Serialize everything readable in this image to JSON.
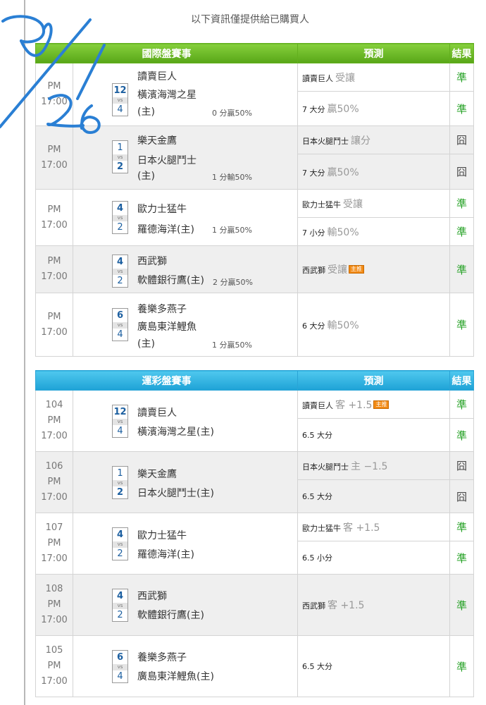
{
  "notice": "以下資訊僅提供給已購買人",
  "intl": {
    "header": {
      "match": "國際盤賽事",
      "pred": "預測",
      "result": "結果"
    },
    "games": [
      {
        "ampm": "PM",
        "time": "17:00",
        "s1": "12",
        "vs": "vs",
        "s2": "4",
        "team1": "讀賣巨人",
        "team2": "橫濱海灣之星",
        "home": "(主)",
        "handicap": "0 分贏50%",
        "pred1_team": "讀賣巨人",
        "pred1_desc": "受讓",
        "res1": "準",
        "pred2_team": "7 大分",
        "pred2_desc": "贏50%",
        "res2": "準"
      },
      {
        "ampm": "PM",
        "time": "17:00",
        "s1": "1",
        "vs": "vs",
        "s2": "2",
        "team1": "樂天金鷹",
        "team2": "日本火腿鬥士",
        "home": "(主)",
        "handicap": "1 分輸50%",
        "pred1_team": "日本火腿鬥士",
        "pred1_desc": "讓分",
        "res1": "囧",
        "pred2_team": "7 大分",
        "pred2_desc": "贏50%",
        "res2": "囧"
      },
      {
        "ampm": "PM",
        "time": "17:00",
        "s1": "4",
        "vs": "vs",
        "s2": "2",
        "team1": "歐力士猛牛",
        "team2": "羅德海洋(主)",
        "handicap": "1 分贏50%",
        "pred1_team": "歐力士猛牛",
        "pred1_desc": "受讓",
        "res1": "準",
        "pred2_team": "7 小分",
        "pred2_desc": "輸50%",
        "res2": "準"
      },
      {
        "ampm": "PM",
        "time": "17:00",
        "s1": "4",
        "vs": "vs",
        "s2": "2",
        "team1": "西武獅",
        "team2": "軟體銀行鷹(主)",
        "handicap": "2 分贏50%",
        "pred_team": "西武獅",
        "pred_desc": "受讓",
        "badge": "主推",
        "res": "準"
      },
      {
        "ampm": "PM",
        "time": "17:00",
        "s1": "6",
        "vs": "vs",
        "s2": "4",
        "team1": "養樂多燕子",
        "team2": "廣島東洋鯉魚",
        "home": "(主)",
        "handicap": "1 分贏50%",
        "pred_team": "6 大分",
        "pred_desc": "輸50%",
        "res": "準"
      }
    ]
  },
  "sports": {
    "header": {
      "match": "運彩盤賽事",
      "pred": "預測",
      "result": "結果"
    },
    "games": [
      {
        "num": "104",
        "ampm": "PM",
        "time": "17:00",
        "s1": "12",
        "vs": "vs",
        "s2": "4",
        "team1": "讀賣巨人",
        "team2": "橫濱海灣之星(主)",
        "pred1_team": "讀賣巨人",
        "pred1_desc": "客 +1.5",
        "badge": "主推",
        "res1": "準",
        "pred2_team": "6.5 大分",
        "res2": "準"
      },
      {
        "num": "106",
        "ampm": "PM",
        "time": "17:00",
        "s1": "1",
        "vs": "vs",
        "s2": "2",
        "team1": "樂天金鷹",
        "team2": "日本火腿鬥士(主)",
        "pred1_team": "日本火腿鬥士",
        "pred1_desc": "主 −1.5",
        "res1": "囧",
        "pred2_team": "6.5 大分",
        "res2": "囧"
      },
      {
        "num": "107",
        "ampm": "PM",
        "time": "17:00",
        "s1": "4",
        "vs": "vs",
        "s2": "2",
        "team1": "歐力士猛牛",
        "team2": "羅德海洋(主)",
        "pred1_team": "歐力士猛牛",
        "pred1_desc": "客 +1.5",
        "res1": "準",
        "pred2_team": "6.5 小分",
        "res2": "準"
      },
      {
        "num": "108",
        "ampm": "PM",
        "time": "17:00",
        "s1": "4",
        "vs": "vs",
        "s2": "2",
        "team1": "西武獅",
        "team2": "軟體銀行鷹(主)",
        "pred_team": "西武獅",
        "pred_desc": "客 +1.5",
        "res": "準"
      },
      {
        "num": "105",
        "ampm": "PM",
        "time": "17:00",
        "s1": "6",
        "vs": "vs",
        "s2": "4",
        "team1": "養樂多燕子",
        "team2": "廣島東洋鯉魚(主)",
        "pred_team": "6.5 大分",
        "res": "準"
      }
    ]
  },
  "colors": {
    "intl_header": "#6bbd2a",
    "sports_header": "#2cb0e0",
    "win": "#22a022",
    "team_score": "#1c5fa0",
    "scribble": "#2a7fd4"
  }
}
